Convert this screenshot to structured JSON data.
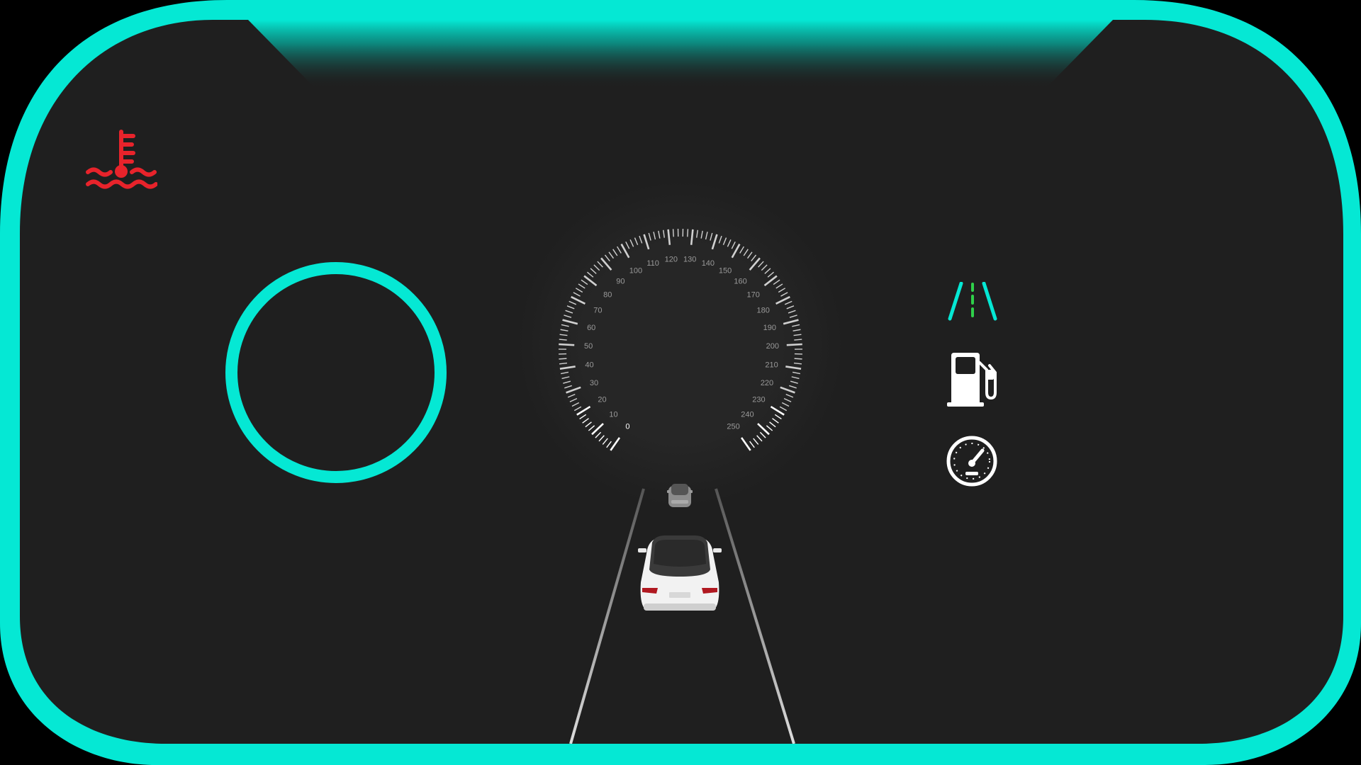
{
  "colors": {
    "accent": "#05e8d4",
    "background": "#1f1f1f",
    "warning": "#e8232b",
    "lane_marker": "#2fd04a",
    "icon_white": "#ffffff"
  },
  "icons": {
    "coolant_warning": "coolant-temperature-warning-icon",
    "lane_assist": "lane-assist-icon",
    "fuel": "fuel-pump-icon",
    "speed_limiter": "speedometer-icon"
  },
  "speedometer": {
    "unit_ticks": [
      "0",
      "10",
      "20",
      "30",
      "40",
      "50",
      "60",
      "70",
      "80",
      "90",
      "100",
      "110",
      "120",
      "130",
      "140",
      "150",
      "160",
      "170",
      "180",
      "190",
      "200",
      "210",
      "220",
      "230",
      "240",
      "250"
    ],
    "min": 0,
    "max": 250,
    "current_speed": 0
  }
}
